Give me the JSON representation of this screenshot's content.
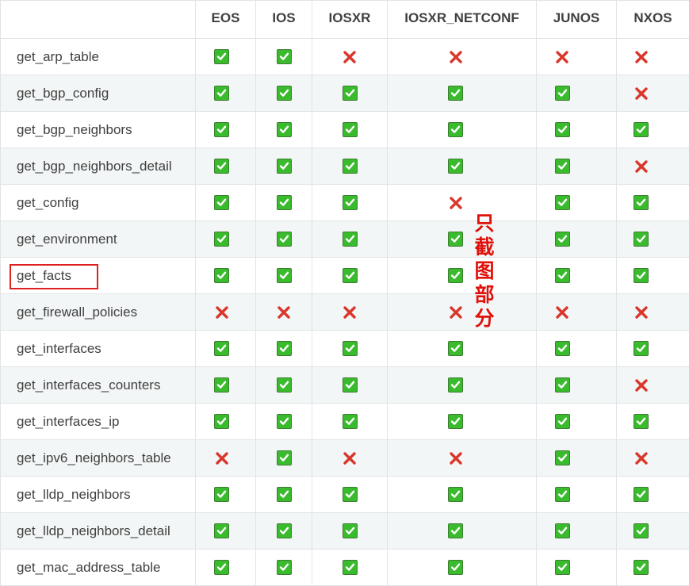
{
  "headers": [
    "",
    "EOS",
    "IOS",
    "IOSXR",
    "IOSXR_NETCONF",
    "JUNOS",
    "NXOS"
  ],
  "rows": [
    {
      "name": "get_arp_table",
      "support": [
        "yes",
        "yes",
        "no",
        "no",
        "no",
        "no"
      ]
    },
    {
      "name": "get_bgp_config",
      "support": [
        "yes",
        "yes",
        "yes",
        "yes",
        "yes",
        "no"
      ]
    },
    {
      "name": "get_bgp_neighbors",
      "support": [
        "yes",
        "yes",
        "yes",
        "yes",
        "yes",
        "yes"
      ]
    },
    {
      "name": "get_bgp_neighbors_detail",
      "support": [
        "yes",
        "yes",
        "yes",
        "yes",
        "yes",
        "no"
      ]
    },
    {
      "name": "get_config",
      "support": [
        "yes",
        "yes",
        "yes",
        "no",
        "yes",
        "yes"
      ]
    },
    {
      "name": "get_environment",
      "support": [
        "yes",
        "yes",
        "yes",
        "yes",
        "yes",
        "yes"
      ]
    },
    {
      "name": "get_facts",
      "support": [
        "yes",
        "yes",
        "yes",
        "yes",
        "yes",
        "yes"
      ],
      "highlighted": true
    },
    {
      "name": "get_firewall_policies",
      "support": [
        "no",
        "no",
        "no",
        "no",
        "no",
        "no"
      ]
    },
    {
      "name": "get_interfaces",
      "support": [
        "yes",
        "yes",
        "yes",
        "yes",
        "yes",
        "yes"
      ]
    },
    {
      "name": "get_interfaces_counters",
      "support": [
        "yes",
        "yes",
        "yes",
        "yes",
        "yes",
        "no"
      ]
    },
    {
      "name": "get_interfaces_ip",
      "support": [
        "yes",
        "yes",
        "yes",
        "yes",
        "yes",
        "yes"
      ]
    },
    {
      "name": "get_ipv6_neighbors_table",
      "support": [
        "no",
        "yes",
        "no",
        "no",
        "yes",
        "no"
      ]
    },
    {
      "name": "get_lldp_neighbors",
      "support": [
        "yes",
        "yes",
        "yes",
        "yes",
        "yes",
        "yes"
      ]
    },
    {
      "name": "get_lldp_neighbors_detail",
      "support": [
        "yes",
        "yes",
        "yes",
        "yes",
        "yes",
        "yes"
      ]
    },
    {
      "name": "get_mac_address_table",
      "support": [
        "yes",
        "yes",
        "yes",
        "yes",
        "yes",
        "yes"
      ]
    }
  ],
  "annotation": {
    "text": "只截图部分",
    "color": "#e0100b"
  },
  "colors": {
    "check_fill": "#3abb2d",
    "cross": "#d9372b",
    "highlight_box": "#e02020"
  },
  "icons": {
    "yes": "checkmark-icon",
    "no": "cross-icon"
  }
}
